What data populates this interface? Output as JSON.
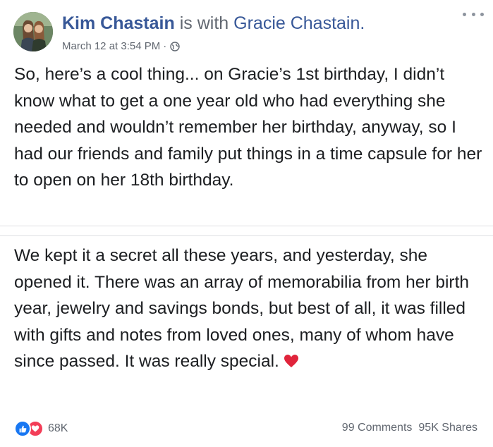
{
  "post": {
    "author": "Kim Chastain",
    "with_text": "is with",
    "tagged": "Gracie Chastain.",
    "timestamp": "March 12 at 3:54 PM",
    "separator": "·",
    "privacy_icon": "globe-icon",
    "more_icon": "more-options-icon",
    "paragraph1": "So, here’s a cool thing... on Gracie’s 1st birthday, I didn’t know what to get a one year old who had everything she needed and wouldn’t remember her birthday, anyway, so I had our friends and family put things in a time capsule for her to open on her 18th birthday.",
    "paragraph2": "We kept it a secret all these years, and yesterday, she opened it. There was an array of memorabilia from her birth year, jewelry and savings bonds, but best of all, it was filled with gifts and notes from loved ones, many of whom have since passed. It was really special.",
    "emoji_icon": "red-heart-icon"
  },
  "footer": {
    "reaction_icons": [
      "like-icon",
      "love-icon"
    ],
    "reaction_count": "68K",
    "comments": "99 Comments",
    "shares": "95K Shares"
  },
  "colors": {
    "link": "#385898",
    "meta": "#616770",
    "text": "#1c1e21",
    "like": "#1877f2",
    "love": "#f33e58"
  }
}
